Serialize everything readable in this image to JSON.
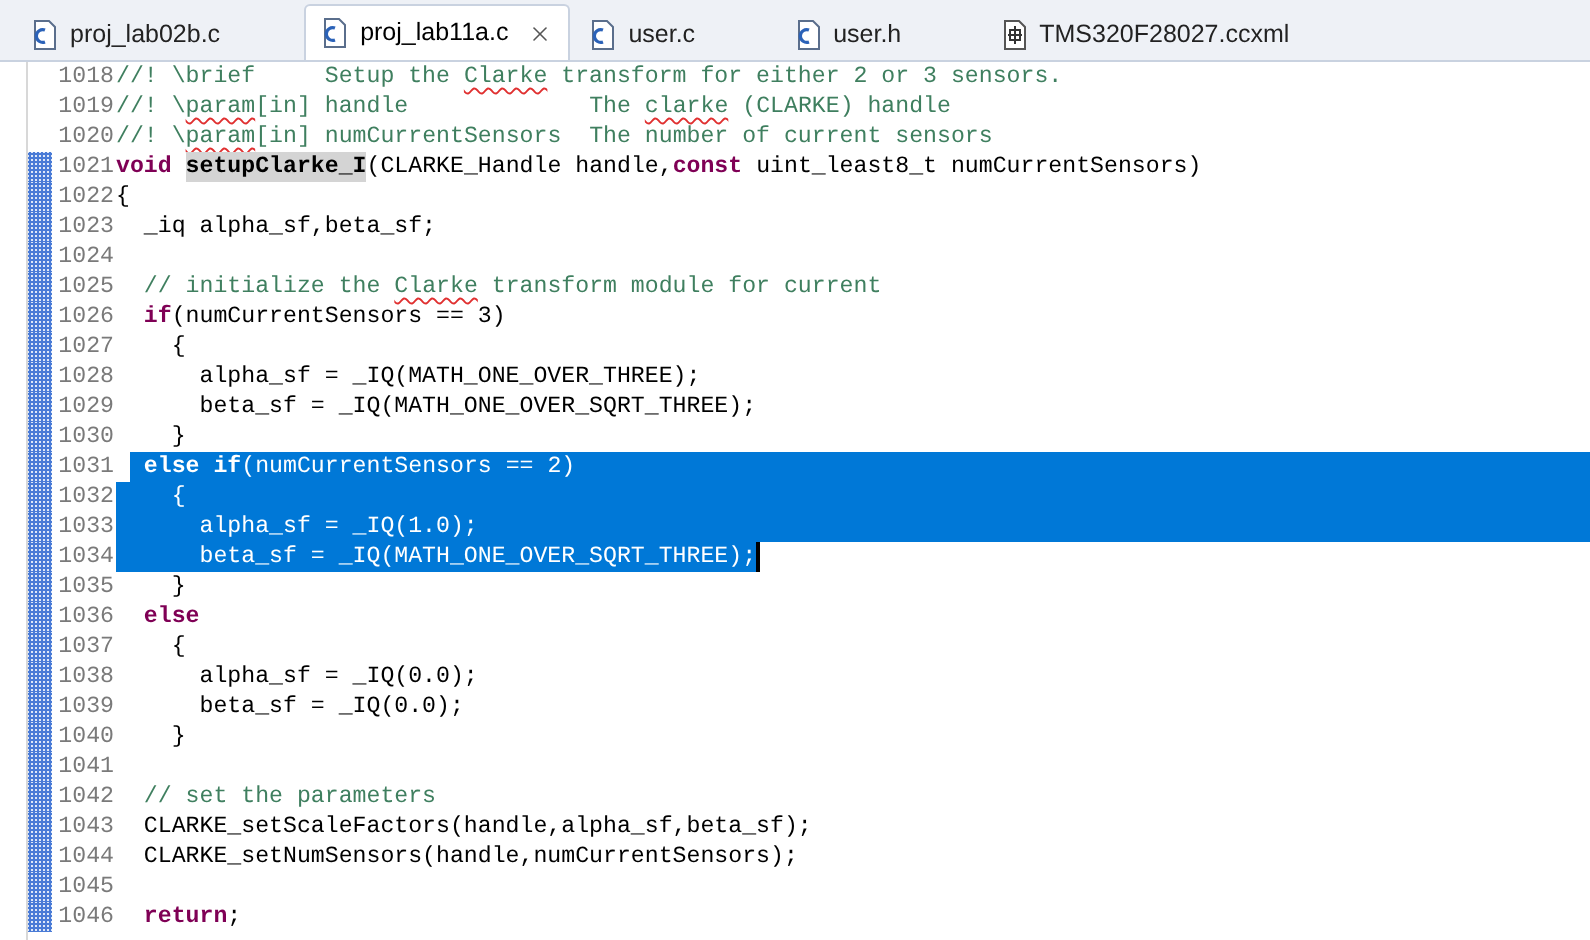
{
  "tabs": [
    {
      "label": "proj_lab02b.c",
      "kind": "c",
      "selected": false,
      "closable": false
    },
    {
      "label": "proj_lab11a.c",
      "kind": "c",
      "selected": true,
      "closable": true
    },
    {
      "label": "user.c",
      "kind": "c",
      "selected": false,
      "closable": false
    },
    {
      "label": "user.h",
      "kind": "c",
      "selected": false,
      "closable": false
    },
    {
      "label": "TMS320F28027.ccxml",
      "kind": "ccxml",
      "selected": false,
      "closable": false
    }
  ],
  "lines": [
    {
      "number": "1018",
      "changed": false,
      "tokens": [
        {
          "text": "//! \\brief     Setup the ",
          "kind": "comment"
        },
        {
          "text": "Clarke",
          "kind": "misspelled"
        },
        {
          "text": " transform for either 2 or 3 sensors.",
          "kind": "comment"
        }
      ]
    },
    {
      "number": "1019",
      "changed": false,
      "tokens": [
        {
          "text": "//! \\",
          "kind": "comment"
        },
        {
          "text": "param",
          "kind": "misspelled"
        },
        {
          "text": "[in] handle             The ",
          "kind": "comment"
        },
        {
          "text": "clarke",
          "kind": "misspelled"
        },
        {
          "text": " (CLARKE) handle",
          "kind": "comment"
        }
      ]
    },
    {
      "number": "1020",
      "changed": false,
      "tokens": [
        {
          "text": "//! \\",
          "kind": "comment"
        },
        {
          "text": "param",
          "kind": "misspelled"
        },
        {
          "text": "[in] numCurrentSensors  The number of current sensors",
          "kind": "comment"
        }
      ]
    },
    {
      "number": "1021",
      "changed": true,
      "tokens": [
        {
          "text": "void ",
          "kind": "keyword"
        },
        {
          "text": "setupClarke_I",
          "kind": "occurrence"
        },
        {
          "text": "(CLARKE_Handle handle,",
          "kind": "plain"
        },
        {
          "text": "const",
          "kind": "keyword"
        },
        {
          "text": " uint_least8_t numCurrentSensors)",
          "kind": "plain"
        }
      ]
    },
    {
      "number": "1022",
      "changed": true,
      "tokens": [
        {
          "text": "{",
          "kind": "plain"
        }
      ]
    },
    {
      "number": "1023",
      "changed": true,
      "tokens": [
        {
          "text": "  _iq alpha_sf,beta_sf;",
          "kind": "plain"
        }
      ]
    },
    {
      "number": "1024",
      "changed": true
    },
    {
      "number": "1025",
      "changed": true,
      "tokens": [
        {
          "text": "  // initialize the ",
          "kind": "comment"
        },
        {
          "text": "Clarke",
          "kind": "misspelled"
        },
        {
          "text": " transform module for current",
          "kind": "comment"
        }
      ]
    },
    {
      "number": "1026",
      "changed": true,
      "tokens": [
        {
          "text": "  if",
          "kind": "keyword"
        },
        {
          "text": "(numCurrentSensors == 3)",
          "kind": "plain"
        }
      ]
    },
    {
      "number": "1027",
      "changed": true,
      "tokens": [
        {
          "text": "    {",
          "kind": "plain"
        }
      ]
    },
    {
      "number": "1028",
      "changed": true,
      "tokens": [
        {
          "text": "      alpha_sf = _IQ(MATH_ONE_OVER_THREE);",
          "kind": "plain"
        }
      ]
    },
    {
      "number": "1029",
      "changed": true,
      "tokens": [
        {
          "text": "      beta_sf = _IQ(MATH_ONE_OVER_SQRT_THREE);",
          "kind": "plain"
        }
      ]
    },
    {
      "number": "1030",
      "changed": true,
      "tokens": [
        {
          "text": "    }",
          "kind": "plain"
        }
      ]
    },
    {
      "number": "1031",
      "changed": true,
      "selection_starts_inside": true,
      "selected_to_end": true,
      "tokens": [
        {
          "text": "  else if",
          "kind": "keyword",
          "selected": true
        },
        {
          "text": "(numCurrentSensors == 2)",
          "kind": "plain",
          "selected": true
        }
      ]
    },
    {
      "number": "1032",
      "changed": true,
      "selected_to_end": true,
      "tokens": [
        {
          "text": "    {",
          "kind": "plain",
          "selected": true
        }
      ]
    },
    {
      "number": "1033",
      "changed": true,
      "selected_to_end": true,
      "tokens": [
        {
          "text": "      alpha_sf = _IQ(1.0);",
          "kind": "plain",
          "selected": true
        }
      ]
    },
    {
      "number": "1034",
      "changed": true,
      "caret": true,
      "tokens": [
        {
          "text": "      beta_sf = _IQ(MATH_ONE_OVER_SQRT_THREE);",
          "kind": "plain",
          "selected": true
        }
      ]
    },
    {
      "number": "1035",
      "changed": true,
      "tokens": [
        {
          "text": "    }",
          "kind": "plain"
        }
      ]
    },
    {
      "number": "1036",
      "changed": true,
      "tokens": [
        {
          "text": "  else",
          "kind": "keyword"
        }
      ]
    },
    {
      "number": "1037",
      "changed": true,
      "tokens": [
        {
          "text": "    {",
          "kind": "plain"
        }
      ]
    },
    {
      "number": "1038",
      "changed": true,
      "tokens": [
        {
          "text": "      alpha_sf = _IQ(0.0);",
          "kind": "plain"
        }
      ]
    },
    {
      "number": "1039",
      "changed": true,
      "tokens": [
        {
          "text": "      beta_sf = _IQ(0.0);",
          "kind": "plain"
        }
      ]
    },
    {
      "number": "1040",
      "changed": true,
      "tokens": [
        {
          "text": "    }",
          "kind": "plain"
        }
      ]
    },
    {
      "number": "1041",
      "changed": true
    },
    {
      "number": "1042",
      "changed": true,
      "tokens": [
        {
          "text": "  // set the parameters",
          "kind": "comment"
        }
      ]
    },
    {
      "number": "1043",
      "changed": true,
      "tokens": [
        {
          "text": "  CLARKE_setScaleFactors(handle,alpha_sf,beta_sf);",
          "kind": "plain"
        }
      ]
    },
    {
      "number": "1044",
      "changed": true,
      "tokens": [
        {
          "text": "  CLARKE_setNumSensors(handle,numCurrentSensors);",
          "kind": "plain"
        }
      ]
    },
    {
      "number": "1045",
      "changed": true
    },
    {
      "number": "1046",
      "changed": true,
      "tokens": [
        {
          "text": "  return",
          "kind": "keyword"
        },
        {
          "text": ";",
          "kind": "plain"
        }
      ]
    }
  ]
}
